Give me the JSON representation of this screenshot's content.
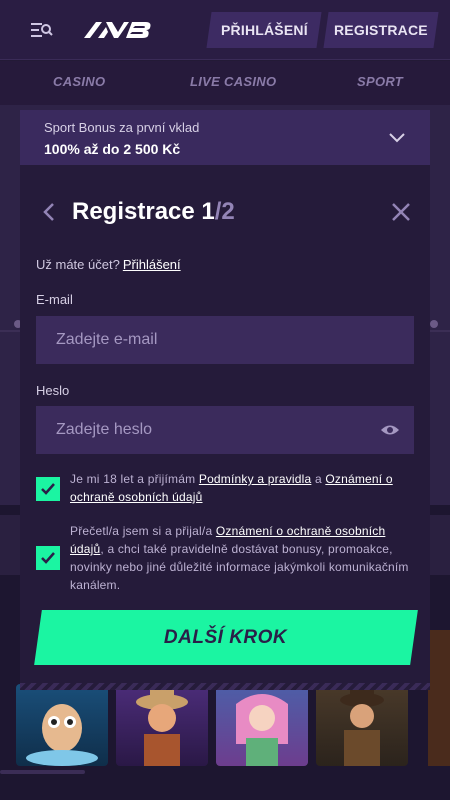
{
  "header": {
    "login_label": "PŘIHLÁŠENÍ",
    "register_label": "REGISTRACE",
    "menu_icon": "menu-search-icon",
    "logo_icon": "brand-logo"
  },
  "nav": {
    "items": [
      {
        "label": "CASINO"
      },
      {
        "label": "LIVE CASINO"
      },
      {
        "label": "SPORT"
      }
    ]
  },
  "promo": {
    "subtitle": "Sport Bonus za první vklad",
    "headline": "100% až do 2 500 Kč",
    "icon": "chevron-down-icon"
  },
  "modal": {
    "title": "Registrace 1",
    "step_separator": "/",
    "step_total": "2",
    "have_account": "Už máte účet?",
    "login_link": "Přihlášení",
    "email": {
      "label": "E-mail",
      "placeholder": "Zadejte e-mail",
      "value": ""
    },
    "password": {
      "label": "Heslo",
      "placeholder": "Zadejte heslo",
      "value": ""
    },
    "consent1": {
      "checked": true,
      "text1": "Je mi 18 let a přijímám",
      "link1": "Podmínky a pravidla",
      "text2": "a",
      "link2": "Oznámení o ochraně osobních údajů"
    },
    "consent2": {
      "checked": true,
      "text1": "Přečetl/a jsem si a přijal/a",
      "link1": "Oznámení o ochraně osobních údajů",
      "text2": ", a chci také pravidelně dostávat bonusy, promoakce, novinky nebo jiné důležité informace jakýmkoli komunikačním kanálem."
    },
    "next_label": "DALŠÍ KROK"
  },
  "colors": {
    "accent": "#1bf5a2",
    "modal_bg": "#251b3a",
    "input_bg": "#3b2b5c",
    "header_bg": "#2a1d43"
  }
}
